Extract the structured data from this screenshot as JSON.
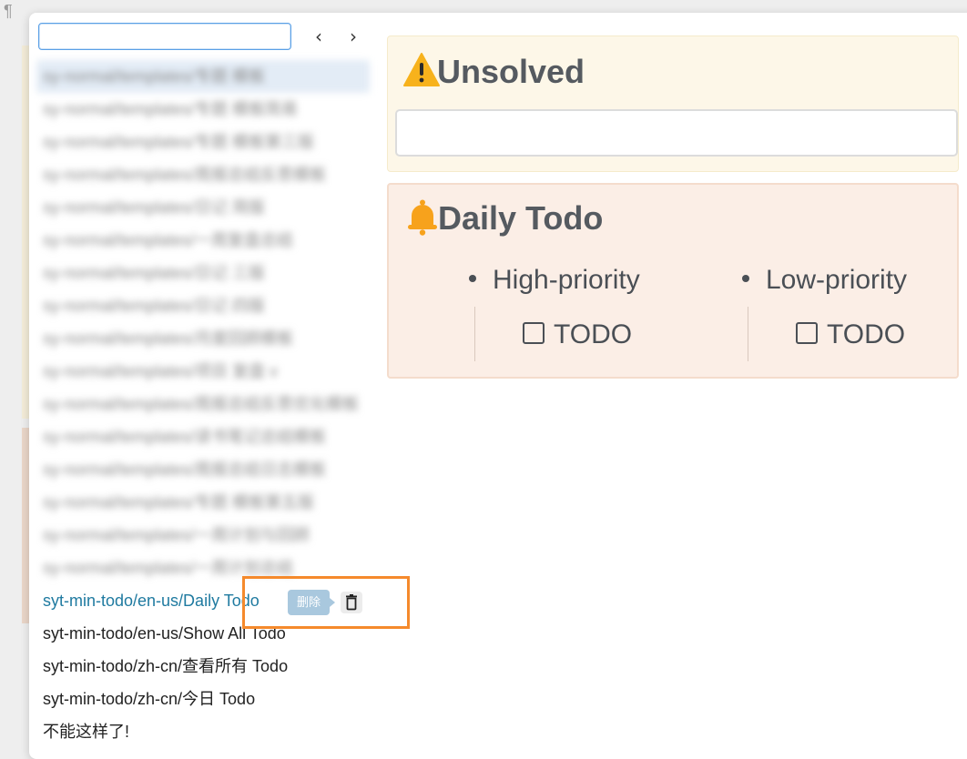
{
  "background": {
    "pilcrow": "¶"
  },
  "search": {
    "value": "",
    "placeholder": ""
  },
  "nav": {
    "prev_icon": "chevron-left-icon",
    "next_icon": "chevron-right-icon"
  },
  "list": {
    "blurred_items": [
      "sy-normal/templates/专题 模板",
      "sy-normal/templates/专题 模板简易",
      "sy-normal/templates/专题 模板第三版",
      "sy-normal/templates/周报总结反思模板",
      "sy-normal/templates/日记 简版",
      "sy-normal/templates/一周复盘总结",
      "sy-normal/templates/日记 三版",
      "sy-normal/templates/日记 四版",
      "sy-normal/templates/月度回顾模板",
      "sy-normal/templates/项目 复盘 v",
      "sy-normal/templates/周报总结反思优化模板",
      "sy-normal/templates/读书笔记总结模板",
      "sy-normal/templates/周报总结日志模板",
      "sy-normal/templates/专题 模板第五版",
      "sy-normal/templates/一周计划与回顾",
      "sy-normal/templates/一周计划总结"
    ],
    "items": [
      "syt-min-todo/en-us/Daily Todo",
      "syt-min-todo/en-us/Show All Todo",
      "syt-min-todo/zh-cn/查看所有 Todo",
      "syt-min-todo/zh-cn/今日 Todo",
      "不能这样了!"
    ]
  },
  "tooltip": {
    "label": "删除"
  },
  "trash": {
    "icon": "trash-icon"
  },
  "preview": {
    "unsolved": {
      "icon": "warning-icon",
      "title": "Unsolved",
      "input_value": ""
    },
    "daily": {
      "icon": "bell-icon",
      "title": "Daily Todo",
      "high_title": "High-priority",
      "high_todo": "TODO",
      "low_title": "Low-priority",
      "low_todo": "TODO"
    }
  },
  "colors": {
    "accent": "#1f7aa0",
    "highlight_border": "#f58a2c",
    "warn_bg": "#fdf7e8",
    "bell_bg": "#fbeee6"
  }
}
